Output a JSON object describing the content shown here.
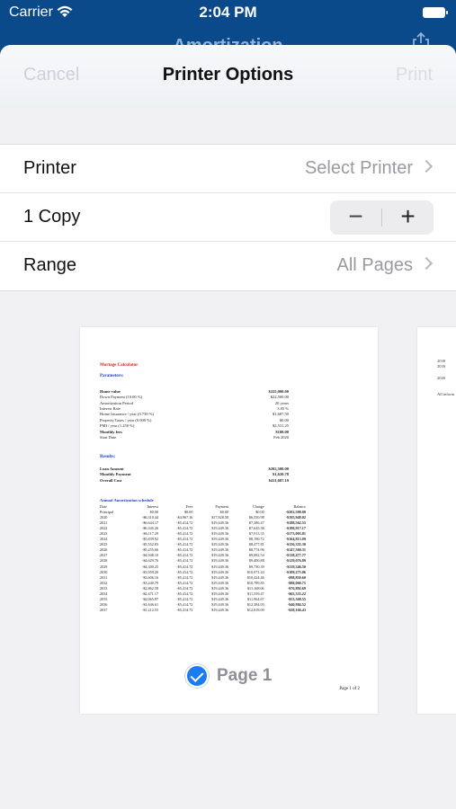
{
  "status_bar": {
    "carrier": "Carrier",
    "time": "2:04 PM"
  },
  "underlying_nav": {
    "title": "Amortization"
  },
  "sheet": {
    "cancel_label": "Cancel",
    "title": "Printer Options",
    "print_label": "Print"
  },
  "options": {
    "printer_label": "Printer",
    "printer_value": "Select Printer",
    "copies_label": "1 Copy",
    "minus": "−",
    "plus": "+",
    "range_label": "Range",
    "range_value": "All Pages"
  },
  "preview": {
    "page_label": "Page 1",
    "page_number": "Page 1 of 2",
    "doc": {
      "title": "Mortage Calculator",
      "params_heading": "Parameters:",
      "params": [
        {
          "k": "Home value",
          "v": "$225,000.00",
          "bold": true
        },
        {
          "k": "Down Payment (10.00 %)",
          "v": "$22,500.00"
        },
        {
          "k": "Amortization Period",
          "v": "20 years"
        },
        {
          "k": "Interest Rate",
          "v": "3.85 %"
        },
        {
          "k": "Home Insurance / year (0.750 %)",
          "v": "$1,687.50"
        },
        {
          "k": "Property Taxes / year (0.000 %)",
          "v": "$0.00"
        },
        {
          "k": "PMI / year (1.250 %)",
          "v": "$2,531.25"
        },
        {
          "k": "Monthly fees",
          "v": "$100.00",
          "bold": true
        },
        {
          "k": "Start Date",
          "v": "Feb 2020"
        }
      ],
      "results_heading": "Results:",
      "results": [
        {
          "k": "Loan Amount",
          "v": "$202,500.00"
        },
        {
          "k": "Monthly Payment",
          "v": "$1,620.78"
        },
        {
          "k": "Overall Cost",
          "v": "$411,687.19"
        }
      ],
      "schedule_heading": "Annual Amortization schedule",
      "schedule_cols": [
        "Date",
        "Interest",
        "Fees",
        "Payment",
        "Change",
        "Balance"
      ],
      "schedule": [
        [
          "Principal",
          "$0.00",
          "$0.00",
          "$0.00",
          "$0.00",
          "-$202,500.00"
        ],
        [
          "2020",
          "-$6,310.44",
          "-$4,967.16",
          "$17,828.58",
          "$6,550.98",
          "-$195,949.02"
        ],
        [
          "2021",
          "-$6,644.17",
          "-$5,414.72",
          "$19,449.36",
          "$7,386.47",
          "-$188,562.55"
        ],
        [
          "2022",
          "-$6,345.26",
          "-$5,414.72",
          "$19,449.36",
          "$7,645.38",
          "-$180,917.17"
        ],
        [
          "2023",
          "-$6,117.29",
          "-$5,414.72",
          "$19,449.36",
          "$7,913.35",
          "-$173,003.81"
        ],
        [
          "2024",
          "-$5,839.92",
          "-$5,414.72",
          "$19,449.36",
          "$8,190.72",
          "-$164,813.09"
        ],
        [
          "2025",
          "-$5,552.83",
          "-$5,414.72",
          "$19,449.36",
          "$8,477.81",
          "-$156,335.30"
        ],
        [
          "2026",
          "-$5,255.66",
          "-$5,414.72",
          "$19,449.36",
          "$8,774.96",
          "-$147,560.31"
        ],
        [
          "2027",
          "-$4,948.10",
          "-$5,414.72",
          "$19,449.36",
          "$9,082.54",
          "-$138,477.77"
        ],
        [
          "2028",
          "-$4,629.76",
          "-$5,414.72",
          "$19,449.36",
          "$9,400.88",
          "-$129,076.89"
        ],
        [
          "2029",
          "-$4,300.25",
          "-$5,414.72",
          "$19,449.36",
          "$9,730.39",
          "-$119,346.50"
        ],
        [
          "2030",
          "-$3,959.20",
          "-$5,414.72",
          "$19,449.36",
          "$10,071.44",
          "-$109,275.06"
        ],
        [
          "2031",
          "-$3,606.16",
          "-$5,414.72",
          "$19,449.36",
          "$10,424.46",
          "-$98,850.60"
        ],
        [
          "2032",
          "-$3,240.79",
          "-$5,414.72",
          "$19,449.36",
          "$10,789.85",
          "-$88,060.75"
        ],
        [
          "2033",
          "-$2,862.58",
          "-$5,414.72",
          "$19,449.36",
          "$11,168.06",
          "-$76,892.69"
        ],
        [
          "2034",
          "-$2,471.17",
          "-$5,414.72",
          "$19,449.36",
          "$11,559.47",
          "-$65,333.22"
        ],
        [
          "2035",
          "-$2,065.97",
          "-$5,414.72",
          "$19,449.36",
          "$11,964.67",
          "-$53,368.55"
        ],
        [
          "2036",
          "-$1,646.61",
          "-$5,414.72",
          "$19,449.36",
          "$12,384.03",
          "-$40,984.52"
        ],
        [
          "2037",
          "-$1,212.55",
          "-$5,414.72",
          "$19,449.36",
          "$12,818.09",
          "-$28,166.43"
        ]
      ]
    },
    "page2_lines": [
      "2038",
      "2039",
      "",
      "2040",
      "",
      "",
      "All inform"
    ]
  }
}
